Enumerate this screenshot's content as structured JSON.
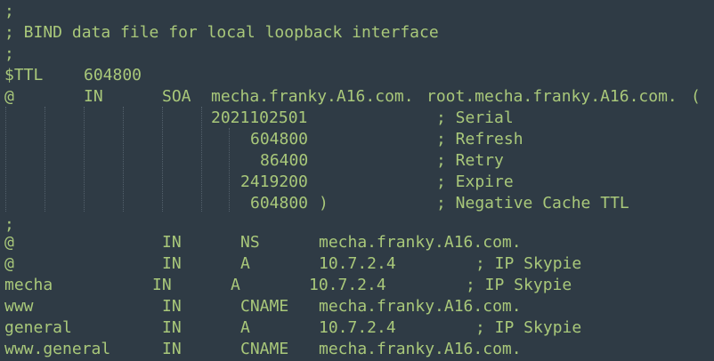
{
  "zone": {
    "header": [
      ";",
      "; BIND data file for local loopback interface",
      ";"
    ],
    "ttl": {
      "directive": "$TTL",
      "value": "604800"
    },
    "soa": {
      "name": "@",
      "class": "IN",
      "type": "SOA",
      "mname": "mecha.franky.A16.com.",
      "rname": "root.mecha.franky.A16.com.",
      "open_paren": "(",
      "serial": {
        "value": "2021102501",
        "comment": "; Serial"
      },
      "refresh": {
        "value": "604800",
        "comment": "; Refresh"
      },
      "retry": {
        "value": "86400",
        "comment": "; Retry"
      },
      "expire": {
        "value": "2419200",
        "comment": "; Expire"
      },
      "negative": {
        "value": "604800",
        "close_paren": ")",
        "comment": "; Negative Cache TTL"
      }
    },
    "separator": ";",
    "records": [
      {
        "name": "@",
        "class": "IN",
        "type": "NS",
        "data": "mecha.franky.A16.com.",
        "comment": ""
      },
      {
        "name": "@",
        "class": "IN",
        "type": "A",
        "data": "10.7.2.4",
        "comment": "; IP Skypie"
      },
      {
        "name": "mecha",
        "class": "IN",
        "type": "A",
        "data": "10.7.2.4",
        "comment": "; IP Skypie"
      },
      {
        "name": "www",
        "class": "IN",
        "type": "CNAME",
        "data": "mecha.franky.A16.com.",
        "comment": ""
      },
      {
        "name": "general",
        "class": "IN",
        "type": "A",
        "data": "10.7.2.4",
        "comment": "; IP Skypie"
      },
      {
        "name": "www.general",
        "class": "IN",
        "type": "CNAME",
        "data": "mecha.franky.A16.com.",
        "comment": ""
      }
    ]
  },
  "colors": {
    "background": "#2f3b45",
    "text": "#a9c87a",
    "indent_guide": "#53606b"
  }
}
